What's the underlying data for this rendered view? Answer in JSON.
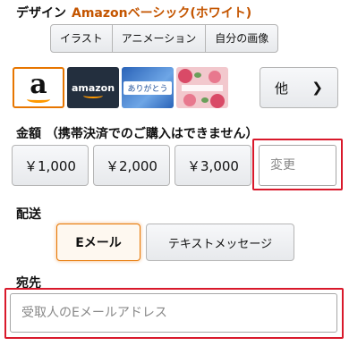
{
  "design": {
    "label": "デザイン",
    "selected": "Amazonベーシック(ホワイト)",
    "tabs": [
      "イラスト",
      "アニメーション",
      "自分の画像"
    ],
    "thumbnails": [
      {
        "name": "amazon-a-white",
        "mark": "a"
      },
      {
        "name": "amazon-wordmark-dark",
        "mark": "amazon"
      },
      {
        "name": "arigatou-card",
        "mark": "ありがとう"
      },
      {
        "name": "floral-card",
        "mark": ""
      }
    ],
    "more_label": "他",
    "more_icon": "chevron-right-icon"
  },
  "amount": {
    "label": "金額 （携帯決済でのご購入はできません）",
    "options": [
      "￥1,000",
      "￥2,000",
      "￥3,000"
    ],
    "custom_placeholder": "変更"
  },
  "delivery": {
    "label": "配送",
    "options": [
      "Eメール",
      "テキストメッセージ"
    ],
    "selected": "Eメール"
  },
  "recipient": {
    "label": "宛先",
    "placeholder": "受取人のEメールアドレス"
  },
  "colors": {
    "accent": "#c45500",
    "selected_border": "#e77600",
    "highlight_red": "#d9192b",
    "amazon_dark": "#232f3e",
    "amazon_orange": "#ff9900"
  }
}
